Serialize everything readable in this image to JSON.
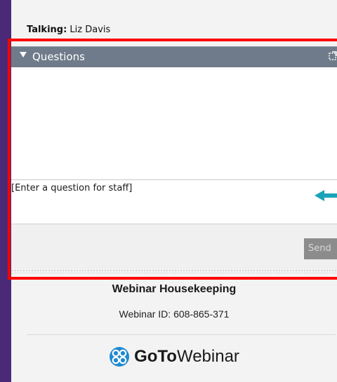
{
  "talking": {
    "label": "Talking:",
    "name": "Liz Davis"
  },
  "questions": {
    "title": "Questions",
    "input_placeholder": "[Enter a question for staff]",
    "send_label": "Send",
    "icons": {
      "collapse": "triangle-down-icon",
      "popout": "popout-icon"
    }
  },
  "annotation": {
    "highlight_color": "#ff0000",
    "arrow_color": "#1aa3b8",
    "arrow_icon": "arrow-left-icon"
  },
  "footer": {
    "title": "Webinar Housekeeping",
    "webinar_id": "Webinar ID: 608-865-371",
    "brand_bold": "GoTo",
    "brand_regular": "Webinar",
    "brand_color": "#1f8bd0",
    "logo_icon": "gotowebinar-logo-icon"
  },
  "colors": {
    "background": "#4a2a78",
    "panel": "#f3f3f3",
    "header_bar": "#6f7b8a",
    "send_button": "#8c8c8c"
  }
}
